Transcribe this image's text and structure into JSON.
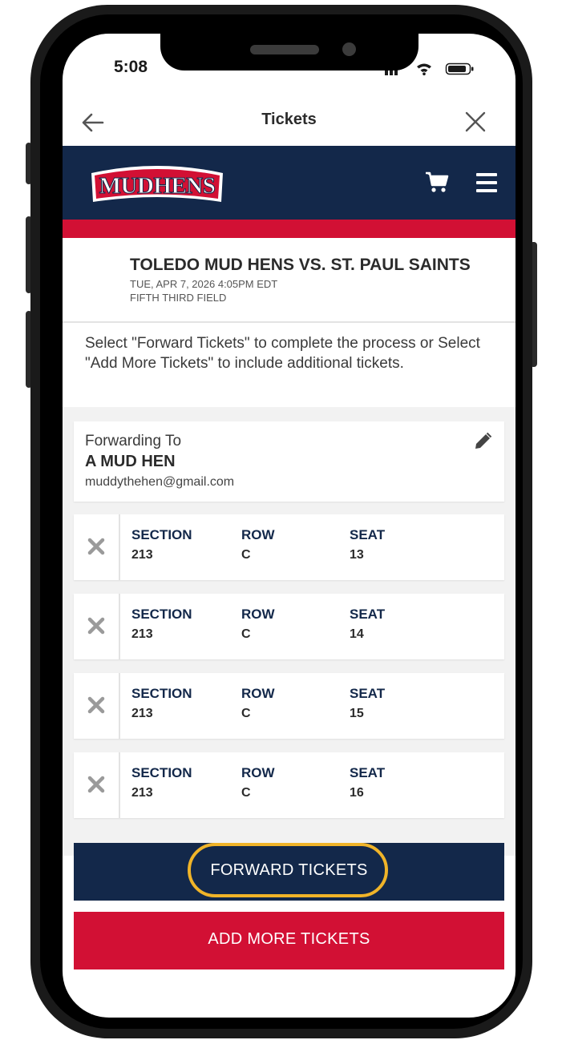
{
  "status_bar": {
    "time": "5:08"
  },
  "nav": {
    "title": "Tickets"
  },
  "brand": {
    "logo_text": "MUDHENS",
    "navy": "#13284a",
    "red": "#d21034",
    "highlight": "#f0b429"
  },
  "event": {
    "title": "TOLEDO MUD HENS VS. ST. PAUL SAINTS",
    "date": "TUE, APR 7, 2026 4:05PM EDT",
    "venue": "FIFTH THIRD FIELD"
  },
  "instructions": "Select \"Forward Tickets\" to complete the process or Select \"Add More Tickets\" to include additional tickets.",
  "forwarding": {
    "label": "Forwarding To",
    "name": "A MUD HEN",
    "email": "muddythehen@gmail.com"
  },
  "ticket_labels": {
    "section": "SECTION",
    "row": "ROW",
    "seat": "SEAT"
  },
  "tickets": [
    {
      "section": "213",
      "row": "C",
      "seat": "13"
    },
    {
      "section": "213",
      "row": "C",
      "seat": "14"
    },
    {
      "section": "213",
      "row": "C",
      "seat": "15"
    },
    {
      "section": "213",
      "row": "C",
      "seat": "16"
    }
  ],
  "buttons": {
    "forward": "FORWARD TICKETS",
    "add_more": "ADD MORE TICKETS"
  },
  "icons": {
    "back": "arrow-left-icon",
    "close": "close-icon",
    "cart": "cart-icon",
    "menu": "hamburger-menu-icon",
    "edit": "pencil-icon",
    "remove": "x-icon"
  }
}
